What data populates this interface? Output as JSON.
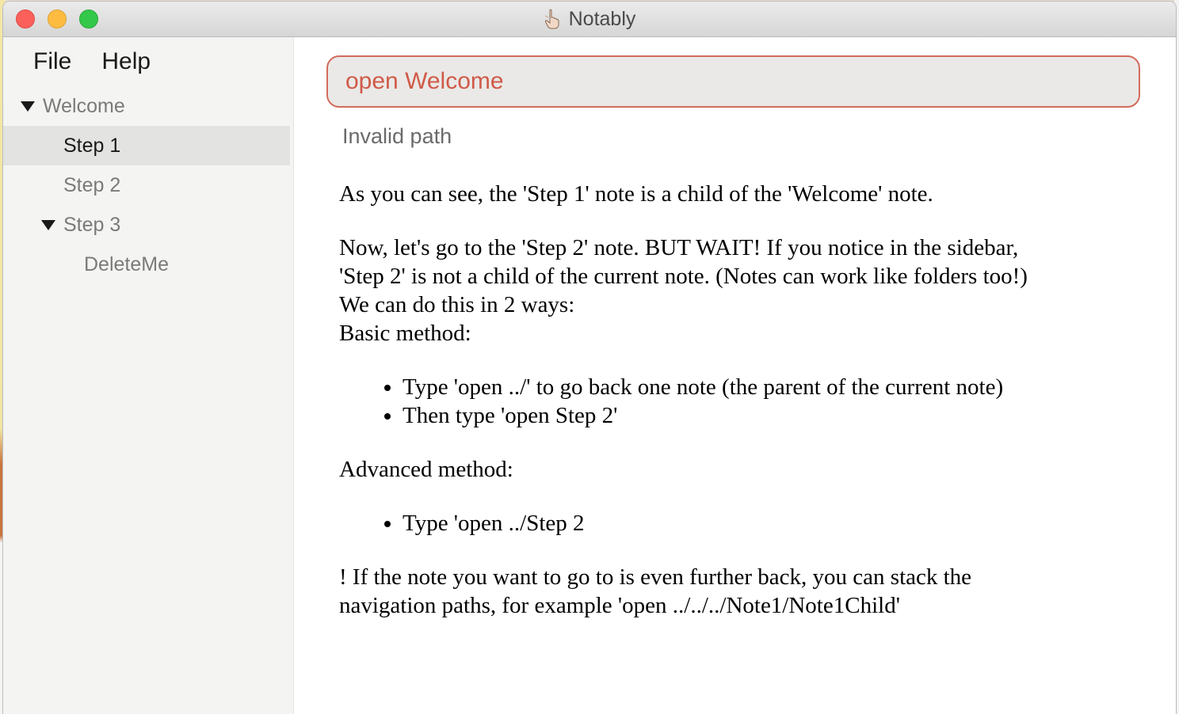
{
  "window": {
    "title": "Notably",
    "app_icon": "pointing-hand-icon",
    "controls": [
      "close",
      "minimize",
      "zoom"
    ]
  },
  "menu": {
    "file": "File",
    "help": "Help"
  },
  "tree": {
    "items": [
      {
        "label": "Welcome",
        "expanded": true,
        "level": 0
      },
      {
        "label": "Step 1",
        "selected": true,
        "level": 1
      },
      {
        "label": "Step 2",
        "level": 1
      },
      {
        "label": "Step 3",
        "expanded": true,
        "level": 1
      },
      {
        "label": "DeleteMe",
        "level": 2
      }
    ]
  },
  "command": {
    "value": "open Welcome"
  },
  "status": "Invalid path",
  "note": {
    "p1": "As you can see, the 'Step 1' note is a child of the 'Welcome' note.",
    "p2_line1": "Now, let's go to the 'Step 2' note. BUT WAIT! If you notice in the sidebar,",
    "p2_line2": "'Step 2' is not a child of the current note. (Notes can work like folders too!)",
    "p2_line3": "We can do this in 2 ways:",
    "p2_line4": "Basic method:",
    "basic_steps": [
      "Type 'open ../' to go back one note (the parent of the current note)",
      "Then type 'open Step 2'"
    ],
    "advanced_heading": "Advanced method:",
    "advanced_steps": [
      "Type 'open ../Step 2"
    ],
    "p_last_line1": "! If the note you want to go to is even further back, you can stack the",
    "p_last_line2": "navigation paths, for example 'open ../../../Note1/Note1Child'"
  },
  "colors": {
    "accent": "#d36b5c",
    "input_text": "#d05a48",
    "selected_row": "#e3e3e1",
    "sidebar_bg": "#f4f4f2"
  }
}
